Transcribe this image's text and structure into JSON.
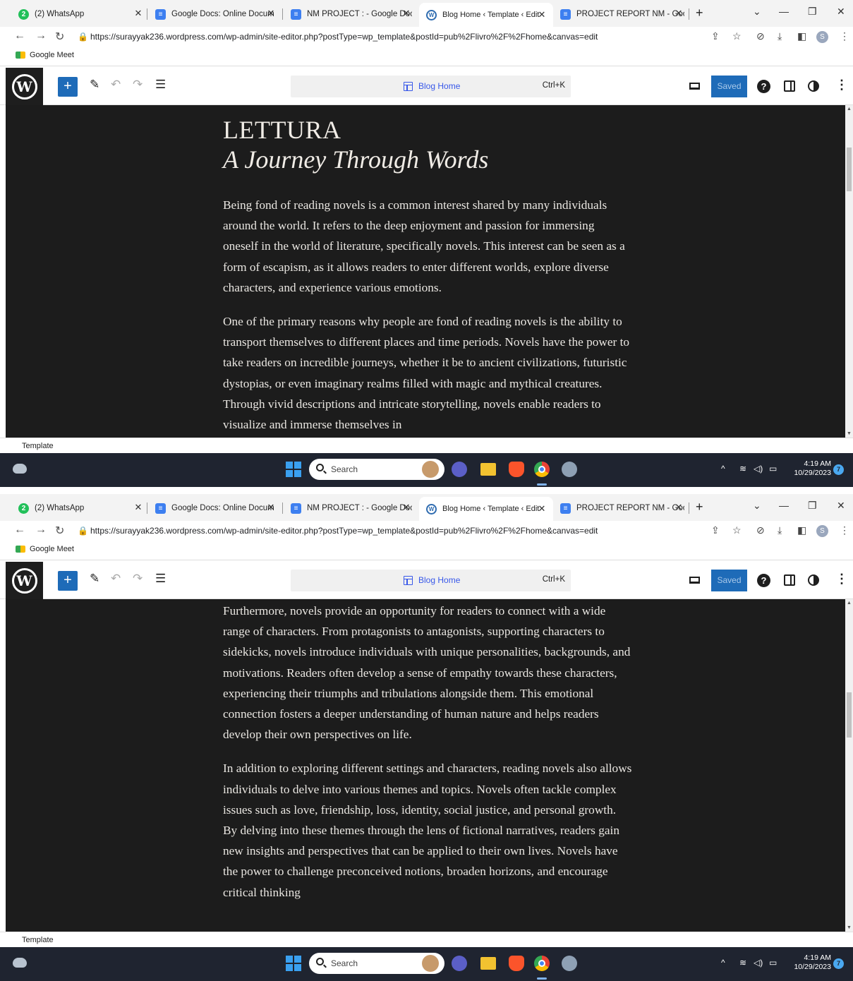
{
  "browser": {
    "tabs": [
      {
        "label": "(2) WhatsApp",
        "icon": "whatsapp-icon"
      },
      {
        "label": "Google Docs: Online Docum",
        "icon": "docs-icon"
      },
      {
        "label": "NM PROJECT : - Google Doc",
        "icon": "docs-icon"
      },
      {
        "label": "Blog Home ‹ Template ‹ Edit",
        "icon": "wordpress-icon",
        "active": true
      },
      {
        "label": "PROJECT REPORT NM - Goo",
        "icon": "docs-icon"
      }
    ],
    "whatsapp_badge": "2",
    "url": "https://surayyak236.wordpress.com/wp-admin/site-editor.php?postType=wp_template&postId=pub%2Flivro%2F%2Fhome&canvas=edit",
    "profile_initial": "S",
    "bookmarks": [
      {
        "label": "Google Meet"
      }
    ]
  },
  "editor": {
    "document_title": "Blog Home",
    "shortcut": "Ctrl+K",
    "save_label": "Saved",
    "help_label": "?",
    "status_label": "Template"
  },
  "content": {
    "site_title": "LETTURA",
    "tagline": "A Journey Through Words",
    "paragraphs": [
      "Being fond of reading novels is a common interest shared by many individuals around the world. It refers to the deep enjoyment and passion for immersing oneself in the world of literature, specifically novels. This interest can be seen as a form of escapism, as it allows readers to enter different worlds, explore diverse characters, and experience various emotions.",
      "One of the primary reasons why people are fond of reading novels is the ability to transport themselves to different places and time periods. Novels have the power to take readers on incredible journeys, whether it be to ancient civilizations, futuristic dystopias, or even imaginary realms filled with magic and mythical creatures. Through vivid descriptions and intricate storytelling, novels enable readers to visualize and immerse themselves in",
      "Furthermore, novels provide an opportunity for readers to connect with a wide range of characters. From protagonists to antagonists, supporting characters to sidekicks, novels introduce individuals with unique personalities, backgrounds, and motivations. Readers often develop a sense of empathy towards these characters, experiencing their triumphs and tribulations alongside them. This emotional connection fosters a deeper understanding of human nature and helps readers develop their own perspectives on life.",
      "In addition to exploring different settings and characters, reading novels also allows individuals to delve into various themes and topics. Novels often tackle complex issues such as love, friendship, loss, identity, social justice, and personal growth. By delving into these themes through the lens of fictional narratives, readers gain new insights and perspectives that can be applied to their own lives. Novels have the power to challenge preconceived notions, broaden horizons, and encourage critical thinking"
    ]
  },
  "taskbar": {
    "search_placeholder": "Search",
    "time": "4:19 AM",
    "date": "10/29/2023",
    "notification_count": "7"
  },
  "colors": {
    "canvas_bg": "#1c1c1c",
    "canvas_text": "#e9e6e1",
    "wp_blue": "#1e6bb8",
    "accent": "#3858e9",
    "taskbar_bg": "#1f2430"
  }
}
